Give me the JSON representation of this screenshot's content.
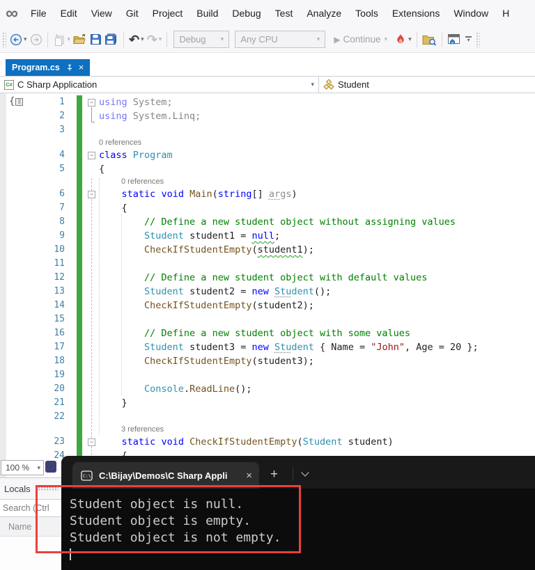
{
  "colors": {
    "active_tab_blue": "#0E70C0",
    "change_bar_green": "#3FA73F",
    "annotation_red": "#E8413C",
    "terminal_bg": "#0C0C0C",
    "keyword_blue": "#0000FF",
    "type_teal": "#2B91AF",
    "method_brown": "#74531F",
    "string_red": "#A31515",
    "comment_green": "#008000"
  },
  "menu_bar": {
    "items": [
      "File",
      "Edit",
      "View",
      "Git",
      "Project",
      "Build",
      "Debug",
      "Test",
      "Analyze",
      "Tools",
      "Extensions",
      "Window",
      "H"
    ]
  },
  "toolbar": {
    "debug_config": "Debug",
    "platform": "Any CPU",
    "continue_label": "Continue"
  },
  "editor_tab": {
    "title": "Program.cs"
  },
  "navigation_bar": {
    "project": "C Sharp Application",
    "member": "Student"
  },
  "editor": {
    "rows": [
      {
        "n": "1",
        "fold": true,
        "fade": true,
        "tokens": [
          [
            "kw",
            "using"
          ],
          [
            "txt",
            " System;"
          ]
        ]
      },
      {
        "n": "2",
        "fade": true,
        "tokens": [
          [
            "kw",
            "using"
          ],
          [
            "txt",
            " System.Linq;"
          ]
        ]
      },
      {
        "n": "3",
        "tokens": []
      },
      {
        "kind": "lens",
        "pad": 0,
        "text": "0 references"
      },
      {
        "n": "4",
        "fold": true,
        "tokens": [
          [
            "kw",
            "class"
          ],
          [
            "txt",
            " "
          ],
          [
            "type",
            "Program"
          ]
        ]
      },
      {
        "n": "5",
        "tokens": [
          [
            "txt",
            "{"
          ]
        ]
      },
      {
        "kind": "lens",
        "pad": 4,
        "text": "0 references"
      },
      {
        "n": "6",
        "fold": true,
        "tokens": [
          [
            "txt",
            "    "
          ],
          [
            "kw",
            "static"
          ],
          [
            "txt",
            " "
          ],
          [
            "kw",
            "void"
          ],
          [
            "txt",
            " "
          ],
          [
            "method",
            "Main"
          ],
          [
            "txt",
            "("
          ],
          [
            "kw",
            "string"
          ],
          [
            "txt",
            "[] "
          ],
          [
            "param dots",
            "ar"
          ],
          [
            "param",
            "gs"
          ],
          [
            "txt",
            ")"
          ]
        ]
      },
      {
        "n": "7",
        "tokens": [
          [
            "txt",
            "    {"
          ]
        ]
      },
      {
        "n": "8",
        "tokens": [
          [
            "txt",
            "        "
          ],
          [
            "cmt",
            "// Define a new student object without assigning values"
          ]
        ]
      },
      {
        "n": "9",
        "tokens": [
          [
            "txt",
            "        "
          ],
          [
            "type",
            "Student"
          ],
          [
            "txt",
            " student1 = "
          ],
          [
            "kw sq",
            "null"
          ],
          [
            "txt",
            ";"
          ]
        ]
      },
      {
        "n": "10",
        "tokens": [
          [
            "txt",
            "        "
          ],
          [
            "method",
            "CheckIfStudentEmpty"
          ],
          [
            "txt",
            "("
          ],
          [
            "txt sq",
            "student1"
          ],
          [
            "txt",
            ");"
          ]
        ]
      },
      {
        "n": "11",
        "tokens": []
      },
      {
        "n": "12",
        "tokens": [
          [
            "txt",
            "        "
          ],
          [
            "cmt",
            "// Define a new student object with default values"
          ]
        ]
      },
      {
        "n": "13",
        "tokens": [
          [
            "txt",
            "        "
          ],
          [
            "type",
            "Student"
          ],
          [
            "txt",
            " student2 = "
          ],
          [
            "kw",
            "new"
          ],
          [
            "txt",
            " "
          ],
          [
            "type dots",
            "Stu"
          ],
          [
            "type",
            "dent"
          ],
          [
            "txt",
            "();"
          ]
        ]
      },
      {
        "n": "14",
        "tokens": [
          [
            "txt",
            "        "
          ],
          [
            "method",
            "CheckIfStudentEmpty"
          ],
          [
            "txt",
            "("
          ],
          [
            "txt",
            "student2"
          ],
          [
            "txt",
            ");"
          ]
        ]
      },
      {
        "n": "15",
        "tokens": []
      },
      {
        "n": "16",
        "tokens": [
          [
            "txt",
            "        "
          ],
          [
            "cmt",
            "// Define a new student object with some values"
          ]
        ]
      },
      {
        "n": "17",
        "tokens": [
          [
            "txt",
            "        "
          ],
          [
            "type",
            "Student"
          ],
          [
            "txt",
            " student3 = "
          ],
          [
            "kw",
            "new"
          ],
          [
            "txt",
            " "
          ],
          [
            "type dots",
            "Stu"
          ],
          [
            "type",
            "dent"
          ],
          [
            "txt",
            " { Name = "
          ],
          [
            "str",
            "\"John\""
          ],
          [
            "txt",
            ", Age = 20 };"
          ]
        ]
      },
      {
        "n": "18",
        "tokens": [
          [
            "txt",
            "        "
          ],
          [
            "method",
            "CheckIfStudentEmpty"
          ],
          [
            "txt",
            "("
          ],
          [
            "txt",
            "student3"
          ],
          [
            "txt",
            ");"
          ]
        ]
      },
      {
        "n": "19",
        "tokens": []
      },
      {
        "n": "20",
        "tokens": [
          [
            "txt",
            "        "
          ],
          [
            "type",
            "Console"
          ],
          [
            "txt",
            "."
          ],
          [
            "method",
            "ReadLine"
          ],
          [
            "txt",
            "();"
          ]
        ]
      },
      {
        "n": "21",
        "tokens": [
          [
            "txt",
            "    }"
          ]
        ]
      },
      {
        "n": "22",
        "tokens": []
      },
      {
        "kind": "lens",
        "pad": 4,
        "text": "3 references"
      },
      {
        "n": "23",
        "fold": true,
        "tokens": [
          [
            "txt",
            "    "
          ],
          [
            "kw",
            "static"
          ],
          [
            "txt",
            " "
          ],
          [
            "kw",
            "void"
          ],
          [
            "txt",
            " "
          ],
          [
            "method",
            "CheckIfStudentEmpty"
          ],
          [
            "txt",
            "("
          ],
          [
            "type",
            "Student"
          ],
          [
            "txt",
            " student)"
          ]
        ]
      },
      {
        "n": "24",
        "tokens": [
          [
            "txt",
            "    {"
          ]
        ]
      }
    ]
  },
  "zoom_control": {
    "value": "100 %"
  },
  "locals_panel": {
    "title": "Locals",
    "search_text": "Search (Ctrl",
    "name_header": "Name"
  },
  "terminal": {
    "tab_title": "C:\\Bijay\\Demos\\C Sharp Appli",
    "output_lines": [
      "Student object is null.",
      "Student object is empty.",
      "Student object is not empty."
    ]
  }
}
